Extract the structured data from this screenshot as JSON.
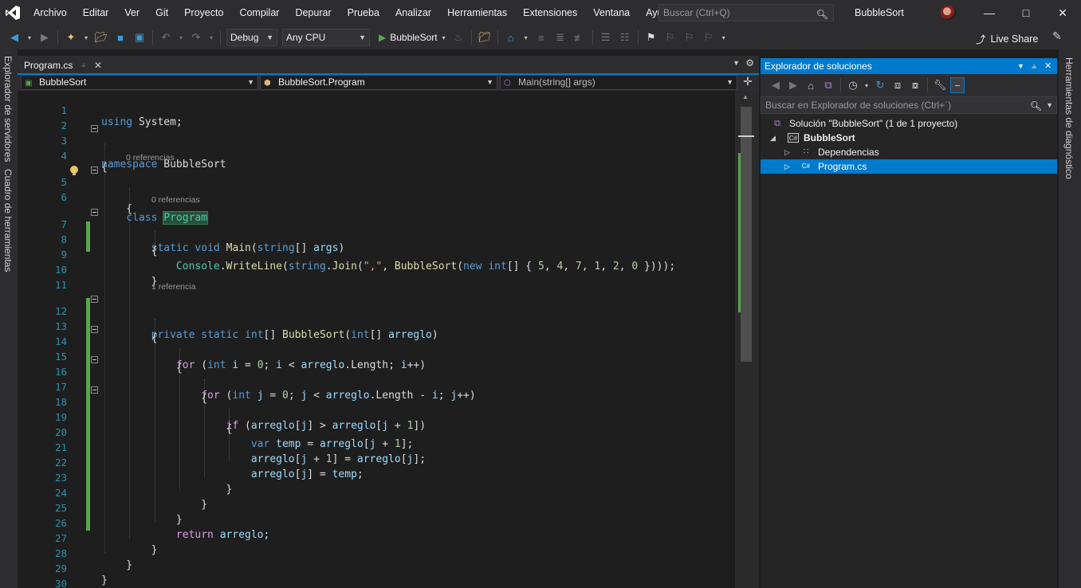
{
  "menu": {
    "items": [
      "Archivo",
      "Editar",
      "Ver",
      "Git",
      "Proyecto",
      "Compilar",
      "Depurar",
      "Prueba",
      "Analizar",
      "Herramientas",
      "Extensiones",
      "Ventana",
      "Ayuda"
    ],
    "search_placeholder": "Buscar (Ctrl+Q)",
    "window_title": "BubbleSort"
  },
  "toolbar": {
    "config": "Debug",
    "platform": "Any CPU",
    "run_label": "BubbleSort",
    "live_share": "Live Share"
  },
  "side_tabs": {
    "left_1": "Explorador de servidores",
    "left_2": "Cuadro de herramientas",
    "right_1": "Herramientas de diagnóstico"
  },
  "editor": {
    "tab_name": "Program.cs",
    "nav_project": "BubbleSort",
    "nav_class": "BubbleSort.Program",
    "nav_member": "Main(string[] args)",
    "lens_0": "0 referencias",
    "lens_1": "0 referencias",
    "lens_2": "1 referencia",
    "line_numbers": [
      "1",
      "2",
      "3",
      "4",
      "5",
      "6",
      "7",
      "8",
      "9",
      "10",
      "11",
      "12",
      "13",
      "14",
      "15",
      "16",
      "17",
      "18",
      "19",
      "20",
      "21",
      "22",
      "23",
      "24",
      "25",
      "26",
      "27",
      "28",
      "29",
      "30"
    ]
  },
  "solution_explorer": {
    "title": "Explorador de soluciones",
    "search_placeholder": "Buscar en Explorador de soluciones (Ctrl+´)",
    "solution": "Solución \"BubbleSort\" (1 de 1 proyecto)",
    "project": "BubbleSort",
    "dependencies": "Dependencias",
    "file": "Program.cs"
  },
  "colors": {
    "accent": "#007acc",
    "keyword": "#569cd6",
    "type": "#4ec9b0",
    "method": "#dcdcaa",
    "string": "#d69d85",
    "number": "#b5cea8",
    "parameter": "#9cdcfe"
  }
}
